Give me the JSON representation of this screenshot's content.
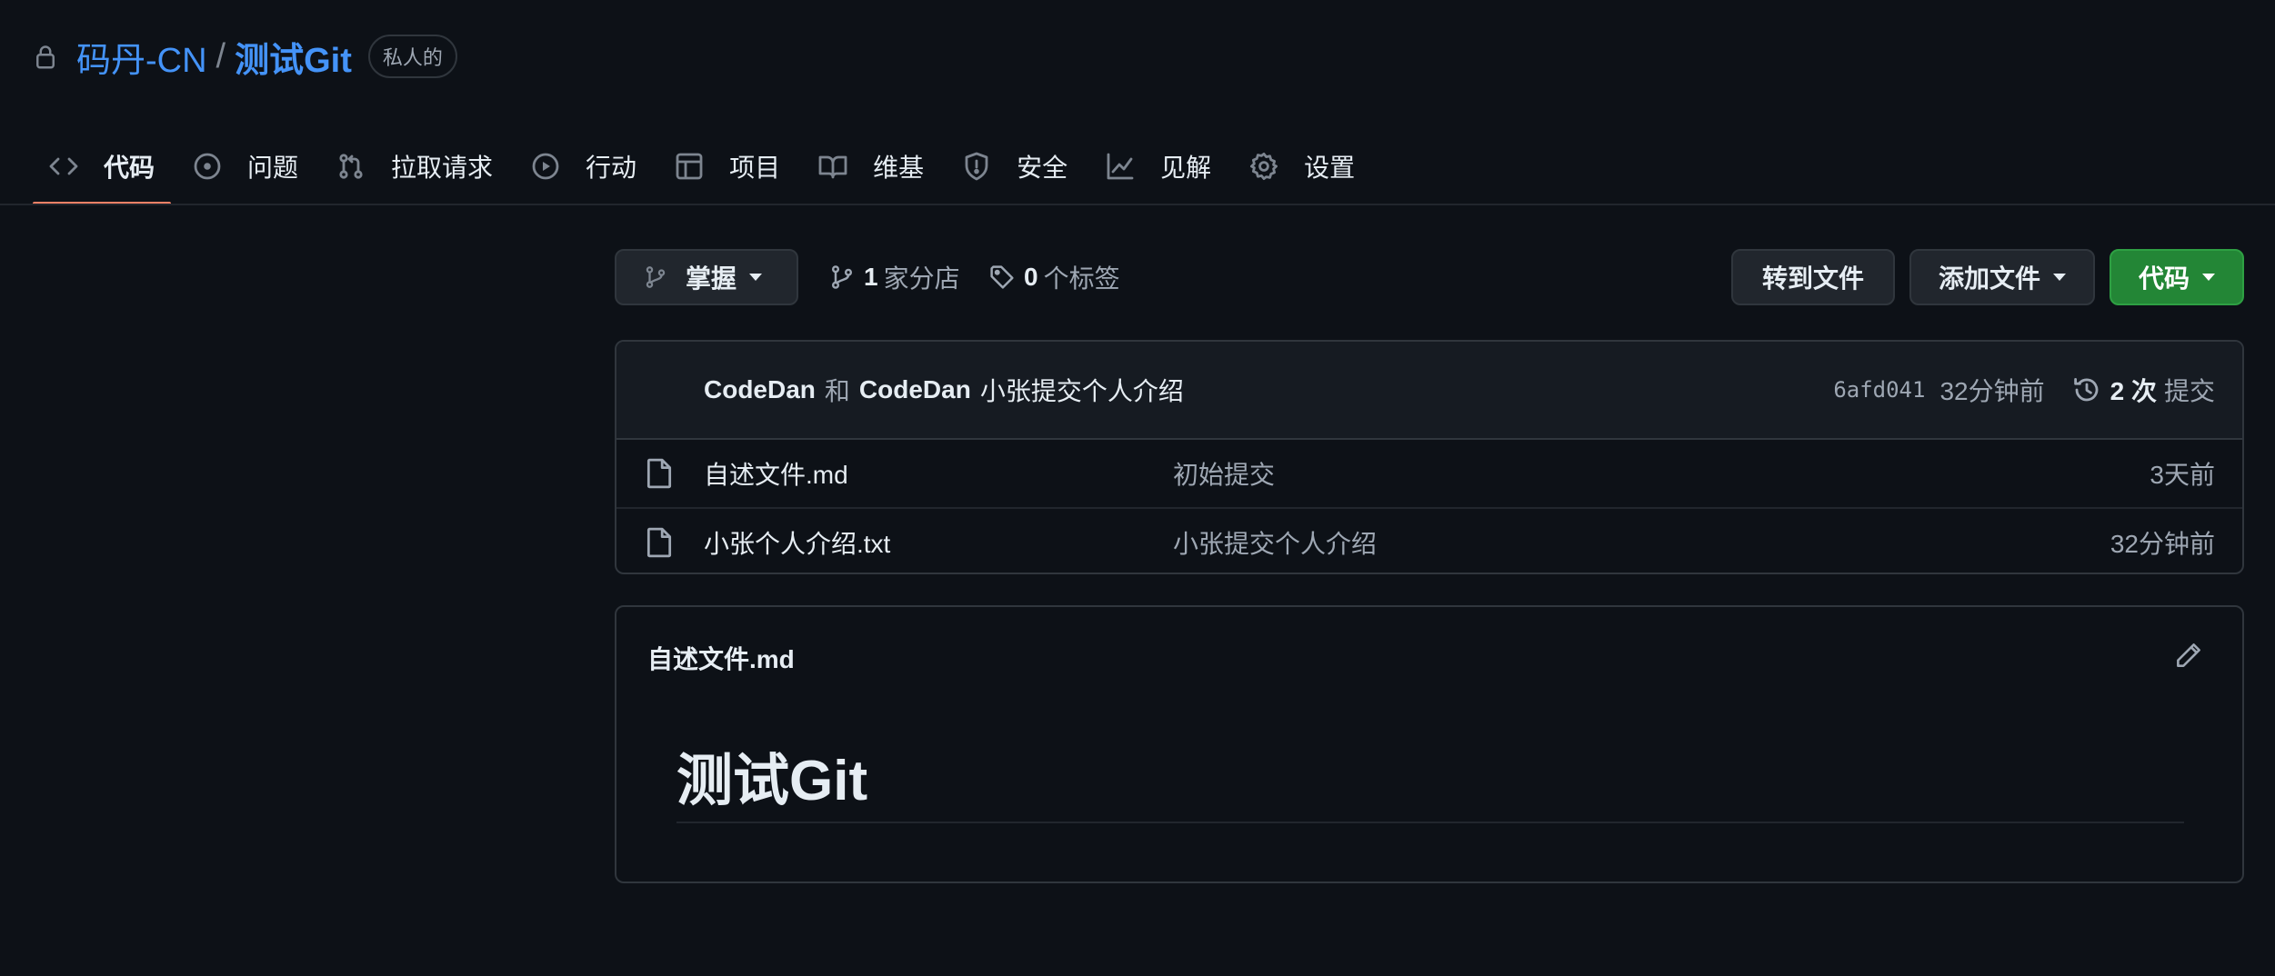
{
  "repo": {
    "owner": "码丹-CN",
    "separator": "/",
    "name": "测试Git",
    "visibility": "私人的"
  },
  "tabs": [
    {
      "label": "代码",
      "icon": "code-icon",
      "active": true
    },
    {
      "label": "问题",
      "icon": "issue-icon"
    },
    {
      "label": "拉取请求",
      "icon": "pull-request-icon"
    },
    {
      "label": "行动",
      "icon": "play-icon"
    },
    {
      "label": "项目",
      "icon": "table-icon"
    },
    {
      "label": "维基",
      "icon": "book-icon"
    },
    {
      "label": "安全",
      "icon": "shield-icon"
    },
    {
      "label": "见解",
      "icon": "graph-icon"
    },
    {
      "label": "设置",
      "icon": "gear-icon"
    }
  ],
  "toolbar": {
    "branch": "掌握",
    "branches_count": "1",
    "branches_label": "家分店",
    "tags_count": "0",
    "tags_label": "个标签",
    "goto_file": "转到文件",
    "add_file": "添加文件",
    "code": "代码"
  },
  "commit": {
    "author1": "CodeDan",
    "and": "和",
    "author2": "CodeDan",
    "message": "小张提交个人介绍",
    "sha": "6afd041",
    "time": "32分钟前",
    "count": "2 次",
    "count_label": "提交"
  },
  "files": [
    {
      "name": "自述文件.md",
      "message": "初始提交",
      "time": "3天前",
      "icon": "file-icon"
    },
    {
      "name": "小张个人介绍.txt",
      "message": "小张提交个人介绍",
      "time": "32分钟前",
      "icon": "file-icon"
    }
  ],
  "readme": {
    "title": "自述文件.md",
    "heading": "测试Git"
  },
  "colors": {
    "background": "#0d1117",
    "link": "#4493f8",
    "active_tab_underline": "#f78166",
    "primary_button": "#238636"
  }
}
